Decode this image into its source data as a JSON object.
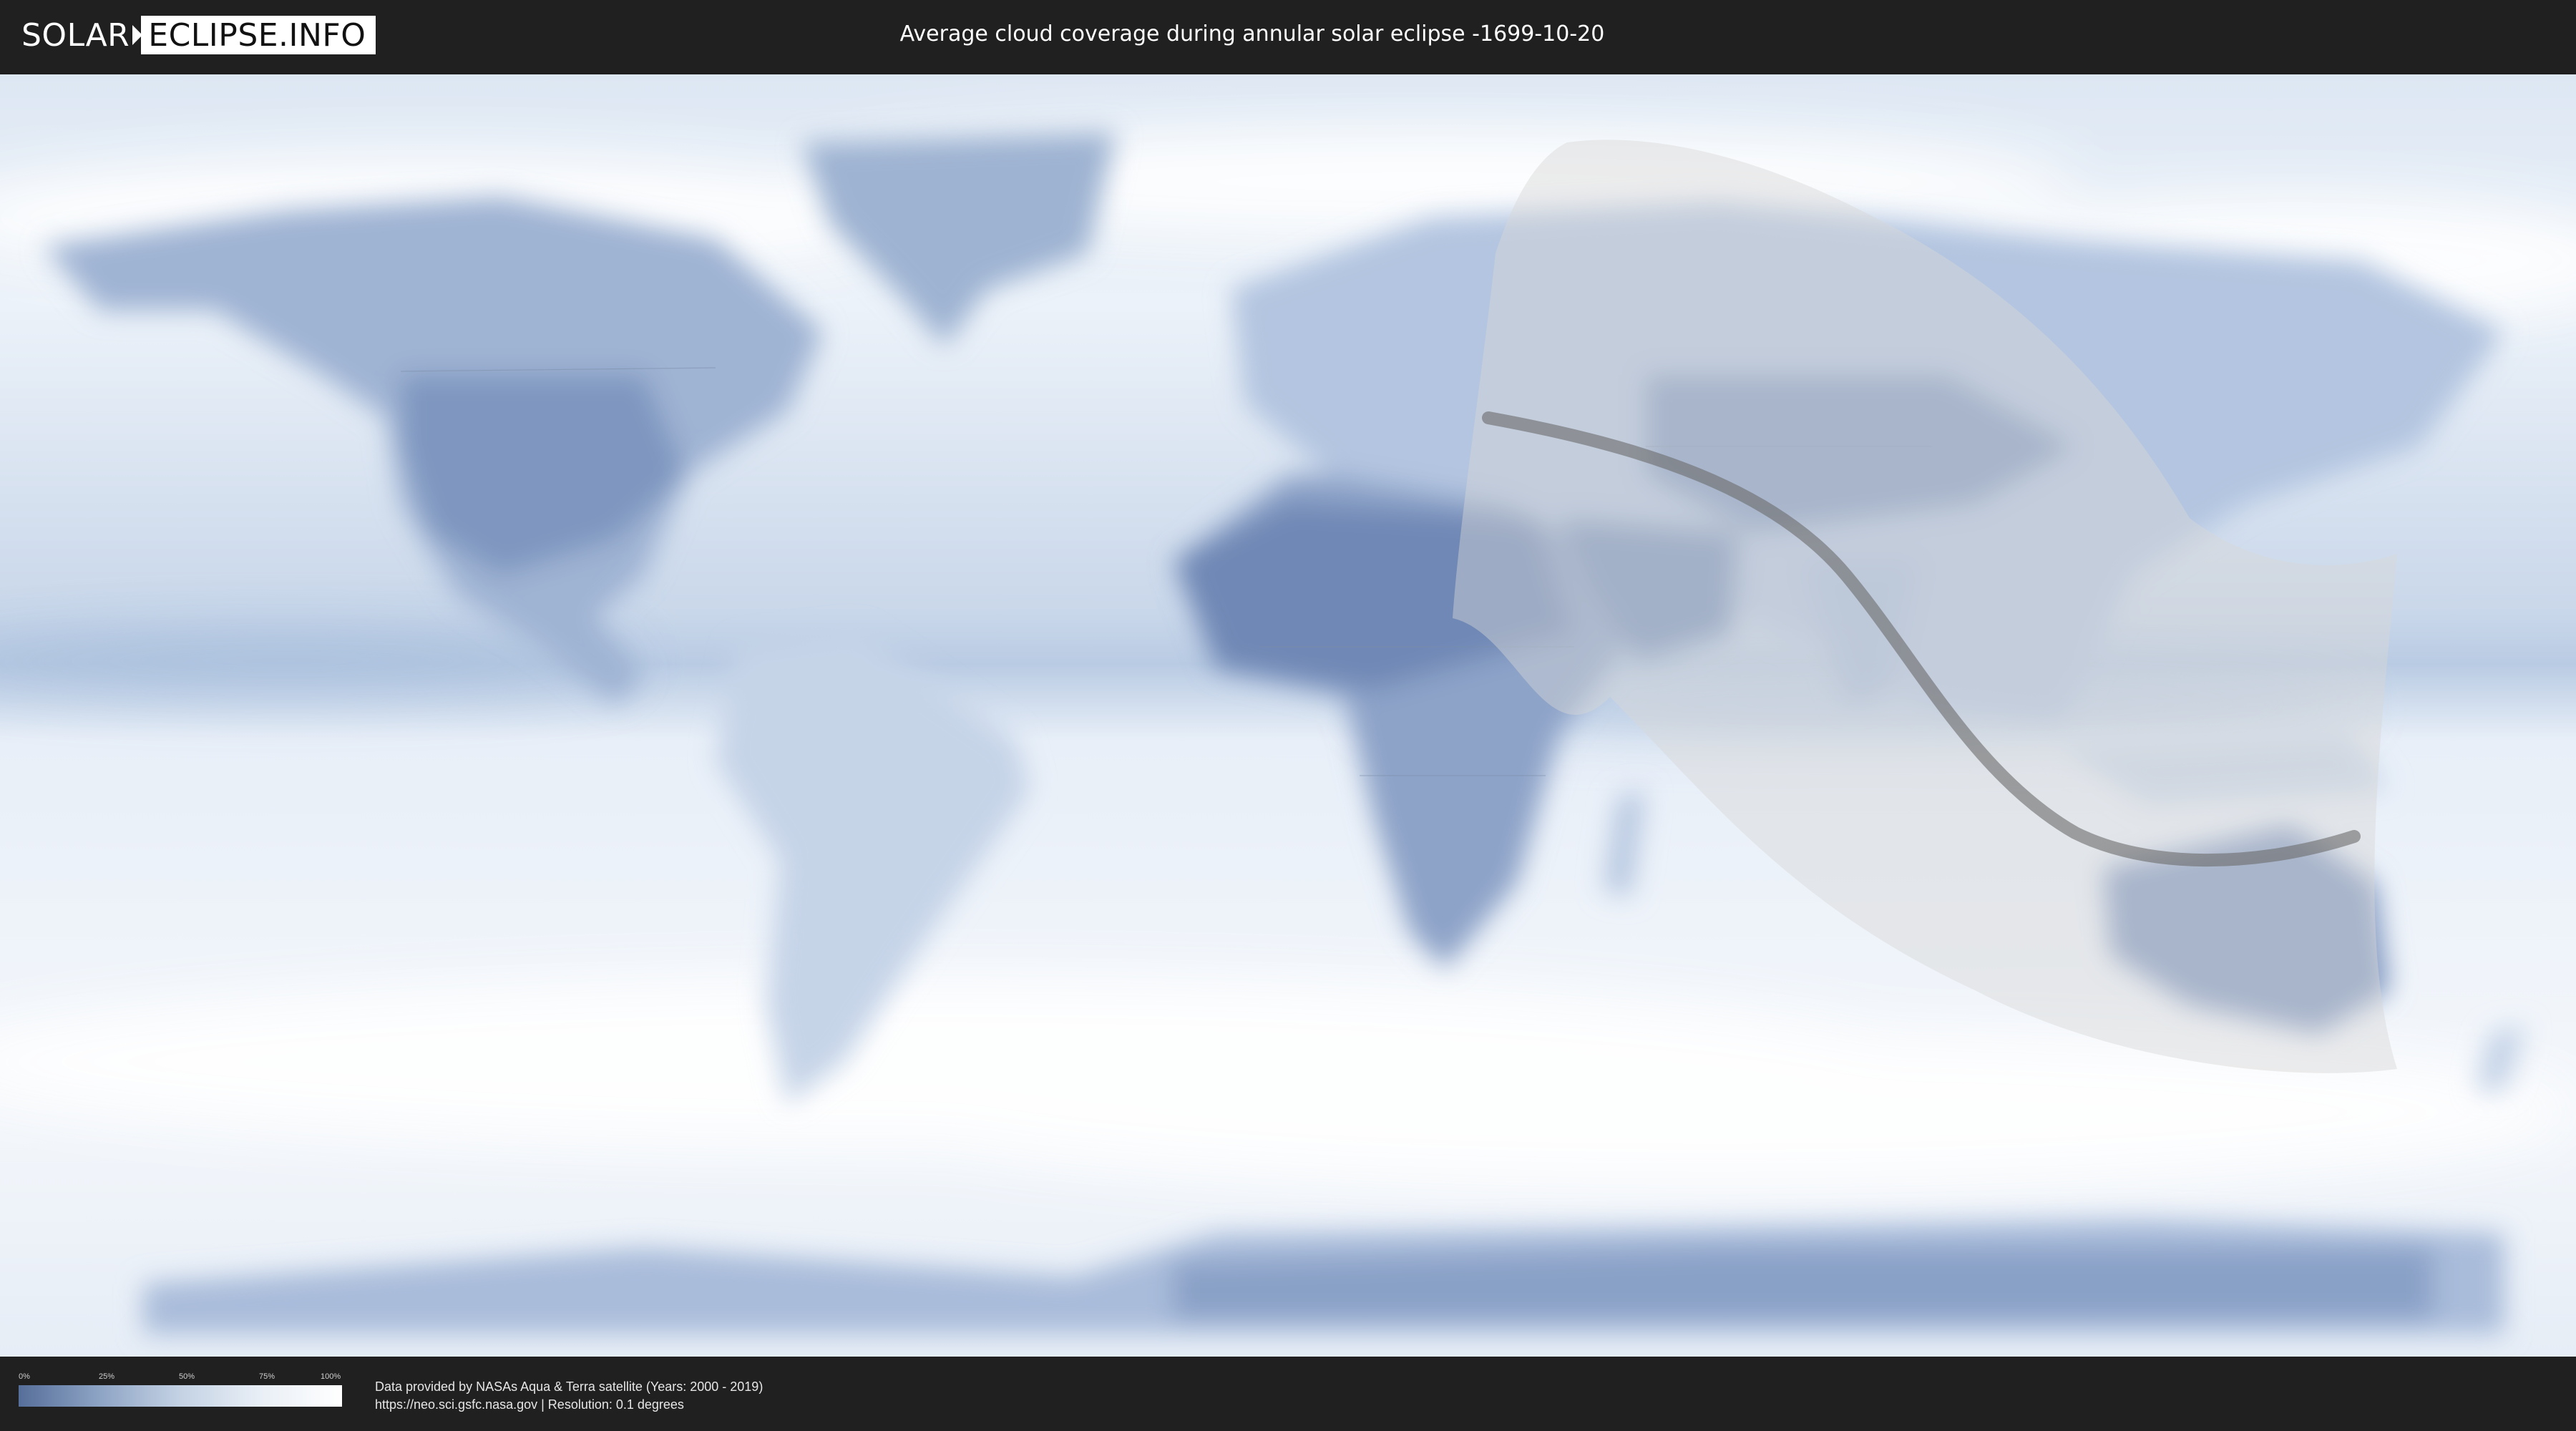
{
  "header": {
    "logo_left": "SOLAR",
    "logo_right": "ECLIPSE.INFO",
    "title": "Average cloud coverage during annular solar eclipse -1699-10-20"
  },
  "legend": {
    "ticks": [
      "0%",
      "25%",
      "50%",
      "75%",
      "100%"
    ],
    "gradient_colors": [
      "#566f9a",
      "#8ea4c5",
      "#c4d2e4",
      "#e9eff6",
      "#ffffff"
    ]
  },
  "footer": {
    "credit_line_1": "Data provided by NASAs Aqua & Terra satellite (Years: 2000 - 2019)",
    "credit_line_2": "https://neo.sci.gsfc.nasa.gov | Resolution: 0.1 degrees"
  },
  "map": {
    "projection": "equirectangular",
    "layer": "average cloud coverage",
    "eclipse_type": "annular",
    "colors": {
      "ocean_clear": "#e9f0f8",
      "cloud_dense": "#ffffff",
      "cloud_low": "#5b77a6",
      "eclipse_region": "#d9d9d9",
      "central_path": "#6b6b6b"
    }
  }
}
